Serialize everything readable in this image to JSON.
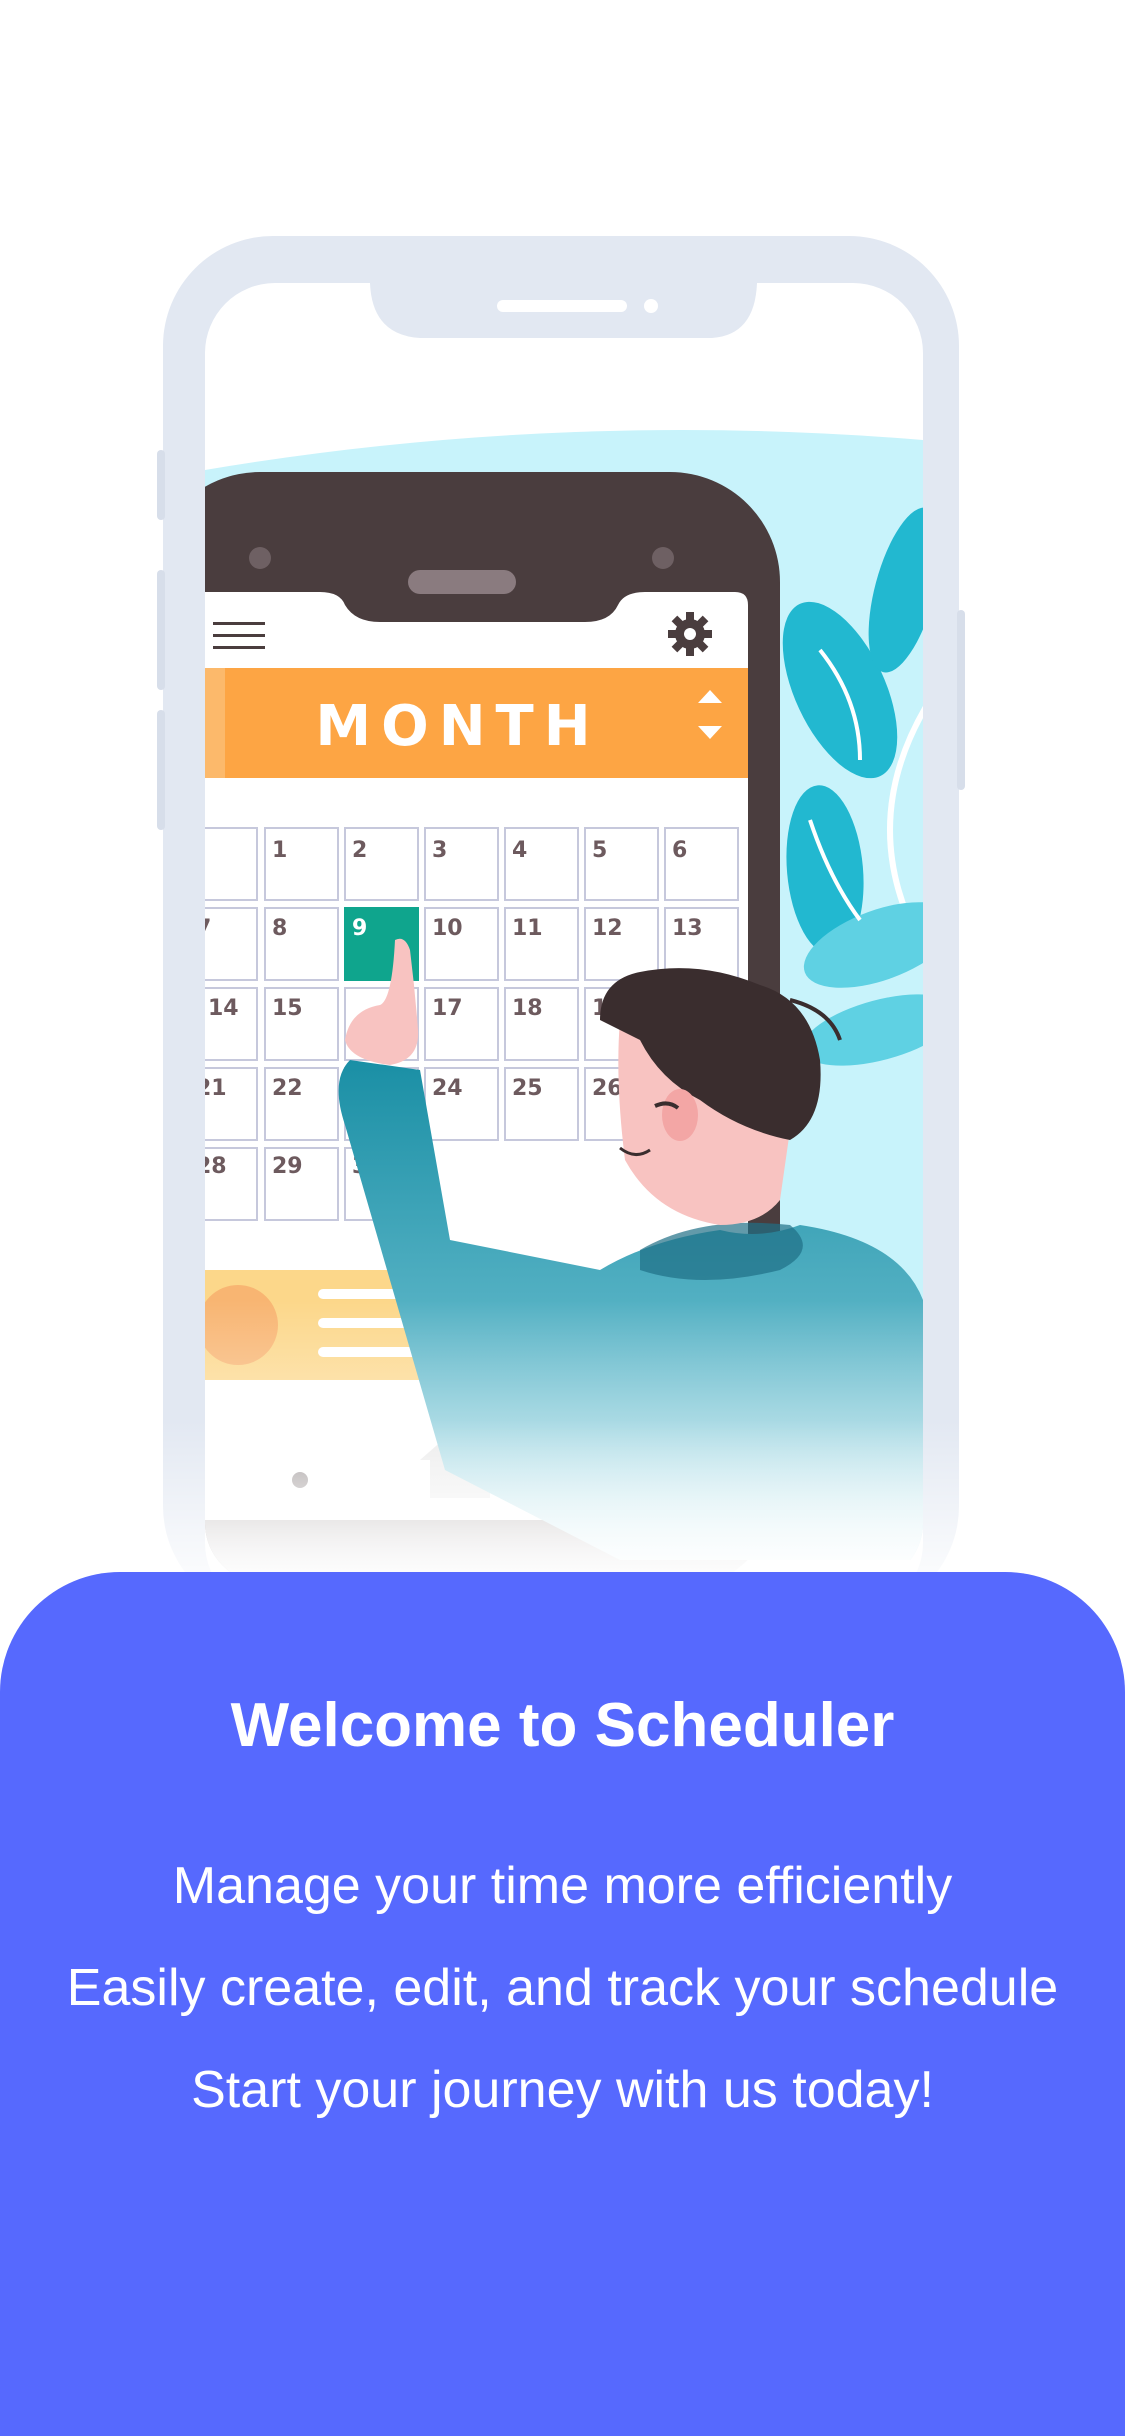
{
  "illustration": {
    "calendar_header": "MONTH",
    "calendar_days": [
      "1",
      "2",
      "3",
      "4",
      "5",
      "6",
      "7",
      "8",
      "9",
      "10",
      "11",
      "12",
      "13",
      "14",
      "15",
      "17",
      "18",
      "19",
      "21",
      "22",
      "24",
      "25",
      "26",
      "28",
      "29",
      "3"
    ],
    "highlighted_day": "9"
  },
  "welcome": {
    "title": "Welcome to Scheduler",
    "taglines": [
      "Manage your time more efficiently",
      "Easily create, edit, and track your schedule",
      "Start your journey with us today!"
    ]
  },
  "colors": {
    "panel": "#5669fe",
    "calendar_header": "#fda544",
    "highlight": "#0fa58d",
    "phone_frame": "#e2e8f2"
  }
}
